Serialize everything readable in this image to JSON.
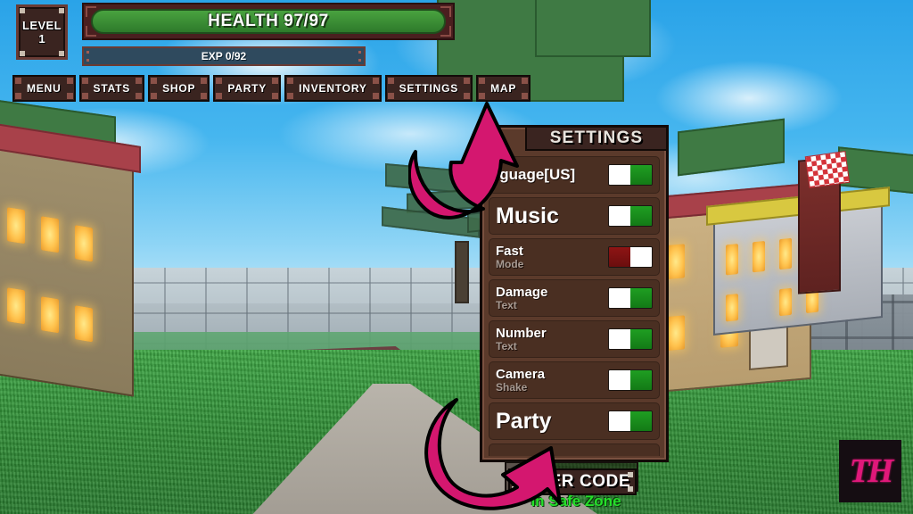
{
  "hud": {
    "level": {
      "label": "LEVEL",
      "value": "1"
    },
    "health": {
      "text": "HEALTH 97/97",
      "current": 97,
      "max": 97
    },
    "exp": {
      "text": "EXP 0/92",
      "current": 0,
      "max": 92
    },
    "menu_buttons": [
      {
        "label": "MENU"
      },
      {
        "label": "STATS"
      },
      {
        "label": "SHOP"
      },
      {
        "label": "PARTY"
      },
      {
        "label": "INVENTORY"
      },
      {
        "label": "SETTINGS"
      },
      {
        "label": "MAP"
      }
    ]
  },
  "settings": {
    "title": "SETTINGS",
    "rows": [
      {
        "line1": "Language[US]",
        "line2": "",
        "toggle": "on",
        "size": "lang"
      },
      {
        "line1": "Music",
        "line2": "",
        "toggle": "on",
        "size": "big"
      },
      {
        "line1": "Fast",
        "line2": "Mode",
        "toggle": "off",
        "size": "sm"
      },
      {
        "line1": "Damage",
        "line2": "Text",
        "toggle": "on",
        "size": "sm"
      },
      {
        "line1": "Number",
        "line2": "Text",
        "toggle": "on",
        "size": "sm"
      },
      {
        "line1": "Camera",
        "line2": "Shake",
        "toggle": "on",
        "size": "sm"
      },
      {
        "line1": "Party",
        "line2": "",
        "toggle": "on",
        "size": "big"
      }
    ]
  },
  "code": {
    "button_label": "ENTER CODE",
    "status_text": "In Safe Zone"
  },
  "annotations": {
    "arrow_up_target": "SETTINGS",
    "arrow_down_target": "ENTER CODE"
  },
  "watermark": {
    "text": "TH"
  },
  "colors": {
    "accent_pink": "#e0187a",
    "toggle_on": "#1f9e22",
    "toggle_off": "#8e1414",
    "panel_brown": "#5b3a2b",
    "row_brown": "#4a2f22",
    "safe_zone_green": "#25e02a",
    "health_green": "#49a23f"
  }
}
